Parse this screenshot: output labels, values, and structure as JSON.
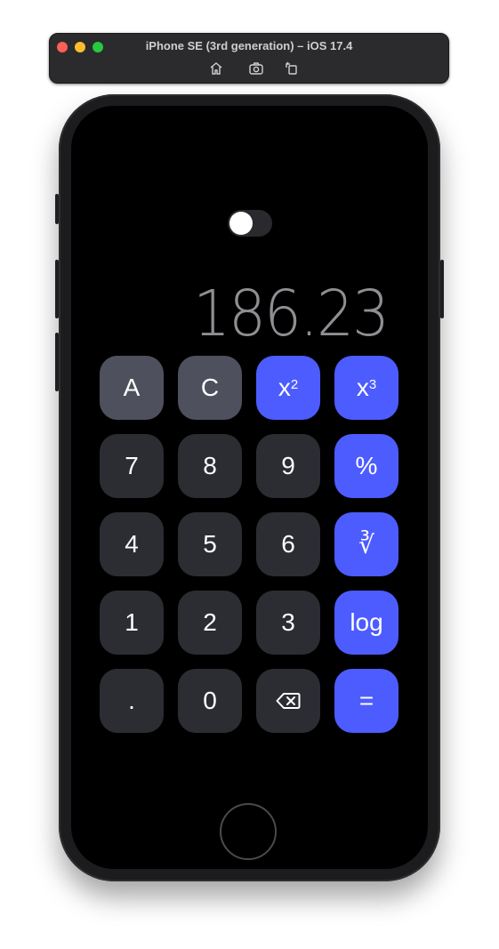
{
  "window": {
    "title": "iPhone SE (3rd generation) – iOS 17.4",
    "toolbar_icons": [
      "home-icon",
      "screenshot-icon",
      "rotate-icon"
    ]
  },
  "calculator": {
    "theme_toggle": {
      "on": false
    },
    "display_value": "186.23",
    "keys": {
      "all_clear": "A",
      "clear": "C",
      "square_base": "x",
      "square_exp": "2",
      "cube_base": "x",
      "cube_exp": "3",
      "seven": "7",
      "eight": "8",
      "nine": "9",
      "percent": "%",
      "four": "4",
      "five": "5",
      "six": "6",
      "cube_root": "∛",
      "one": "1",
      "two": "2",
      "three": "3",
      "log": "log",
      "decimal": ".",
      "zero": "0",
      "backspace_icon": "delete-left-icon",
      "equals": "="
    },
    "colors": {
      "accent": "#4d5cff",
      "light_key": "#4e505d",
      "dark_key": "#2c2c33",
      "display_text": "#8e8e93"
    }
  }
}
